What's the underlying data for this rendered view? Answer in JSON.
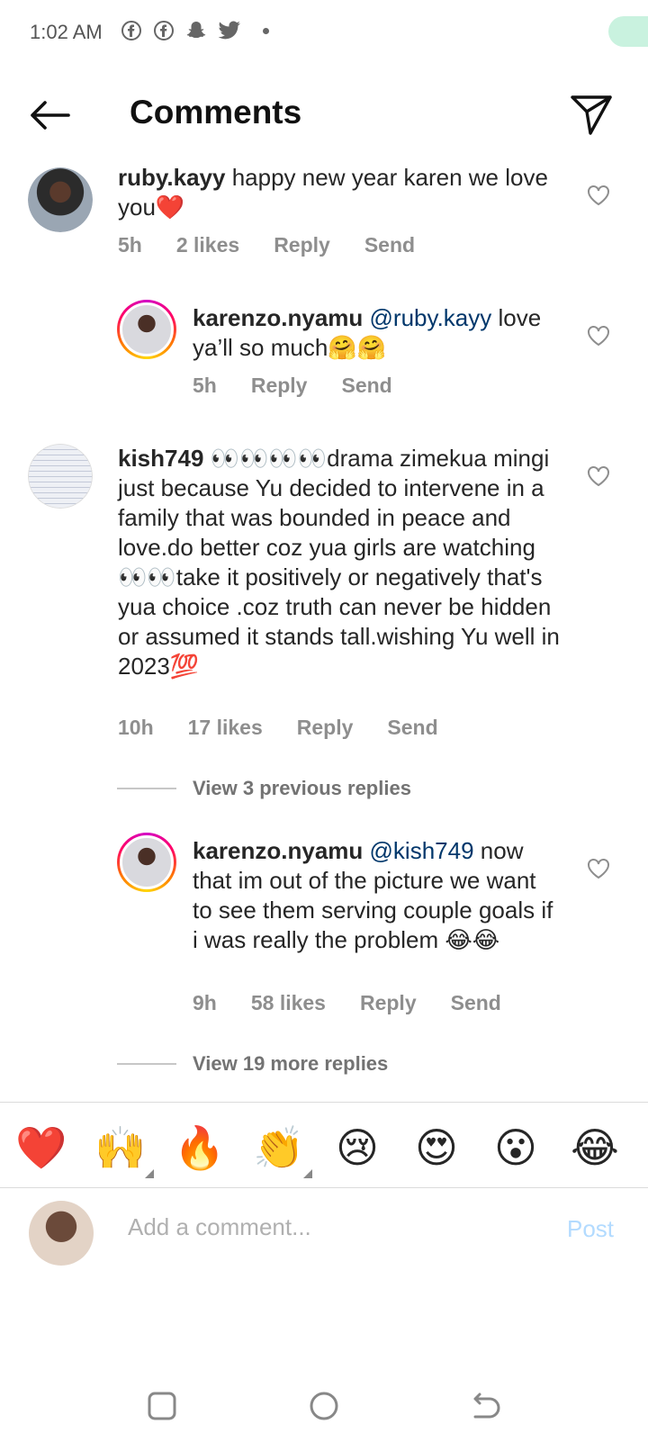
{
  "status_bar": {
    "time": "1:02 AM",
    "notification_icons": [
      "facebook-icon",
      "facebook-icon",
      "snapchat-icon",
      "twitter-icon"
    ]
  },
  "header": {
    "title": "Comments"
  },
  "comments": [
    {
      "username": "ruby.kayy",
      "text": "happy new year karen we love you",
      "emoji": "❤️",
      "time": "5h",
      "likes": "2 likes",
      "reply_label": "Reply",
      "send_label": "Send"
    },
    {
      "username": "karenzo.nyamu",
      "mention": "@ruby.kayy",
      "text": "love ya’ll so much",
      "emoji": "🤗🤗",
      "time": "5h",
      "reply_label": "Reply",
      "send_label": "Send"
    },
    {
      "username": "kish749",
      "text_1": "👀👀👀👀drama zimekua mingi just because Yu decided to intervene in a family that was bounded in peace and love.do better coz yua girls are watching 👀👀take it positively or negatively that's yua choice .coz truth can never be hidden or assumed it stands tall.wishing Yu well in 2023",
      "emoji": "💯",
      "time": "10h",
      "likes": "17 likes",
      "reply_label": "Reply",
      "send_label": "Send"
    },
    {
      "username": "karenzo.nyamu",
      "mention": "@kish749",
      "text": "now that im out of the picture we want to see them serving couple goals if i was really the problem",
      "emoji": "😂😂",
      "time": "9h",
      "likes": "58 likes",
      "reply_label": "Reply",
      "send_label": "Send"
    }
  ],
  "view_previous_replies": "View 3 previous replies",
  "view_more_replies": "View 19 more replies",
  "reactions": [
    "❤️",
    "🙌",
    "🔥",
    "👏",
    "😢",
    "😍",
    "😮",
    "😂"
  ],
  "composer": {
    "placeholder": "Add a comment...",
    "post_label": "Post"
  },
  "colors": {
    "mention": "#00376b",
    "meta_gray": "#8e8e8e",
    "post_disabled": "#b3dbff"
  }
}
